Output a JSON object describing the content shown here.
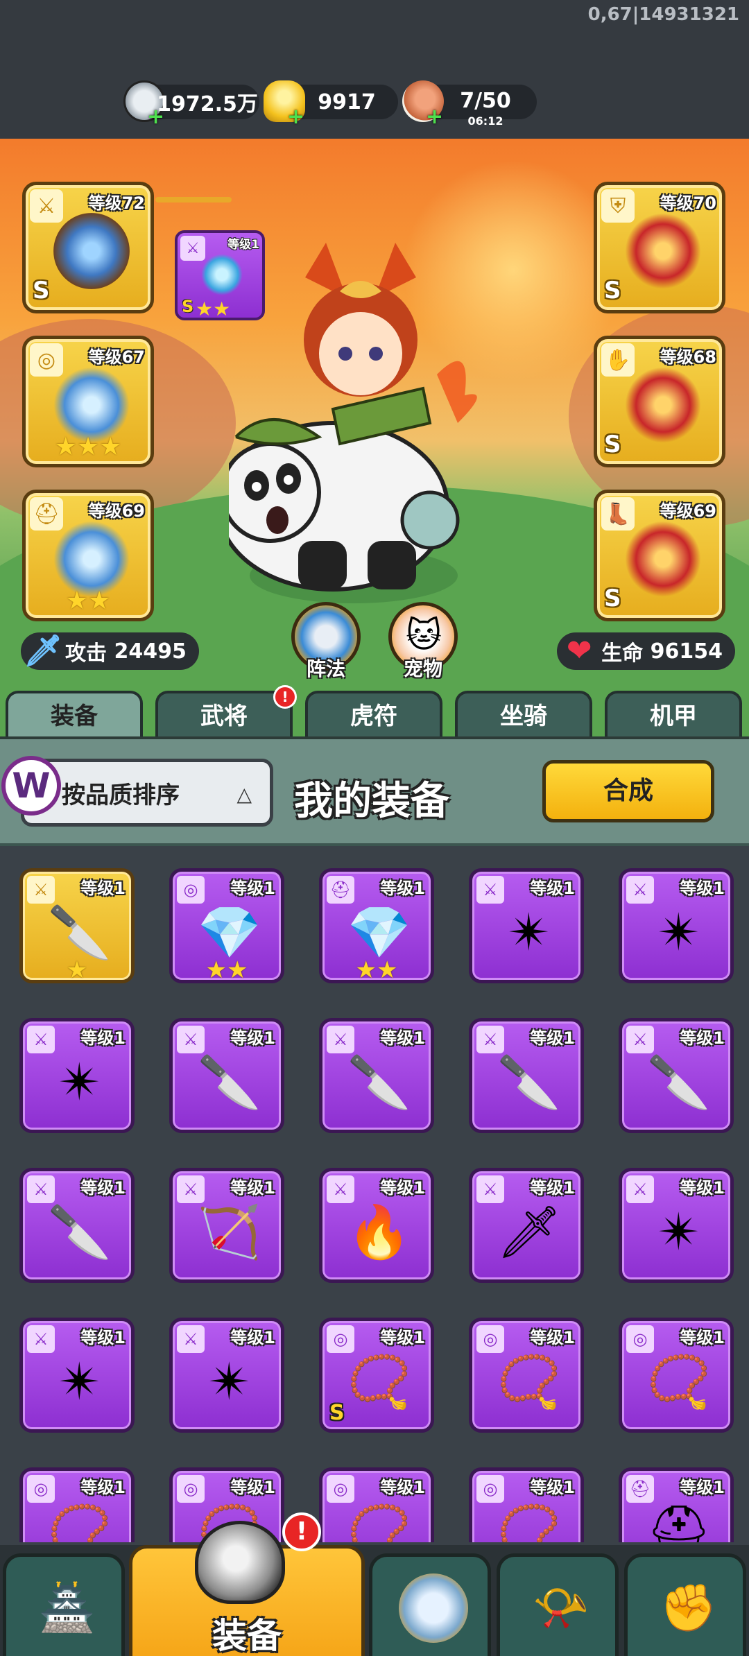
{
  "status": {
    "build": "0,67|14931321"
  },
  "resources": [
    {
      "name": "silver-coin-icon",
      "value": "1972.5万"
    },
    {
      "name": "gold-ingot-icon",
      "value": "9917"
    },
    {
      "name": "meat-stamina-icon",
      "value": "7/50",
      "timer": "06:12"
    }
  ],
  "equipped": {
    "left": [
      {
        "level": "等级72",
        "grade": "S"
      },
      {
        "level": "等级67",
        "stars": "★★★"
      },
      {
        "level": "等级69",
        "stars": "★★"
      }
    ],
    "pet_weapon": {
      "level": "等级1",
      "grade": "S",
      "stars": "★★"
    },
    "right": [
      {
        "level": "等级70",
        "grade": "S"
      },
      {
        "level": "等级68",
        "grade": "S"
      },
      {
        "level": "等级69",
        "grade": "S"
      }
    ]
  },
  "stats": {
    "attack_label": "攻击",
    "attack_value": "24495",
    "hp_label": "生命",
    "hp_value": "96154"
  },
  "circle_buttons": {
    "formation": "阵法",
    "pet": "宠物"
  },
  "tabs": [
    {
      "label": "装备",
      "active": true
    },
    {
      "label": "武将",
      "badge": "!"
    },
    {
      "label": "虎符"
    },
    {
      "label": "坐骑"
    },
    {
      "label": "机甲"
    }
  ],
  "panel": {
    "sort_label": "按品质排序",
    "logo": "W",
    "title": "我的装备",
    "merge_label": "合成"
  },
  "inventory": [
    {
      "level": "等级1",
      "gold": true,
      "stars": "★"
    },
    {
      "level": "等级1",
      "stars": "★★"
    },
    {
      "level": "等级1",
      "stars": "★★"
    },
    {
      "level": "等级1"
    },
    {
      "level": "等级1"
    },
    {
      "level": "等级1"
    },
    {
      "level": "等级1"
    },
    {
      "level": "等级1"
    },
    {
      "level": "等级1"
    },
    {
      "level": "等级1"
    },
    {
      "level": "等级1"
    },
    {
      "level": "等级1"
    },
    {
      "level": "等级1"
    },
    {
      "level": "等级1"
    },
    {
      "level": "等级1"
    },
    {
      "level": "等级1"
    },
    {
      "level": "等级1"
    },
    {
      "level": "等级1",
      "grade": "S"
    },
    {
      "level": "等级1"
    },
    {
      "level": "等级1"
    },
    {
      "level": "等级1"
    },
    {
      "level": "等级1"
    },
    {
      "level": "等级1"
    },
    {
      "level": "等级1"
    },
    {
      "level": "等级1"
    }
  ],
  "bottom_nav": {
    "equipment_label": "装备",
    "alert": "!"
  },
  "colors": {
    "gold_tier": "#f0c232",
    "purple_tier": "#a447e2",
    "panel_teal": "#6f8f86"
  }
}
